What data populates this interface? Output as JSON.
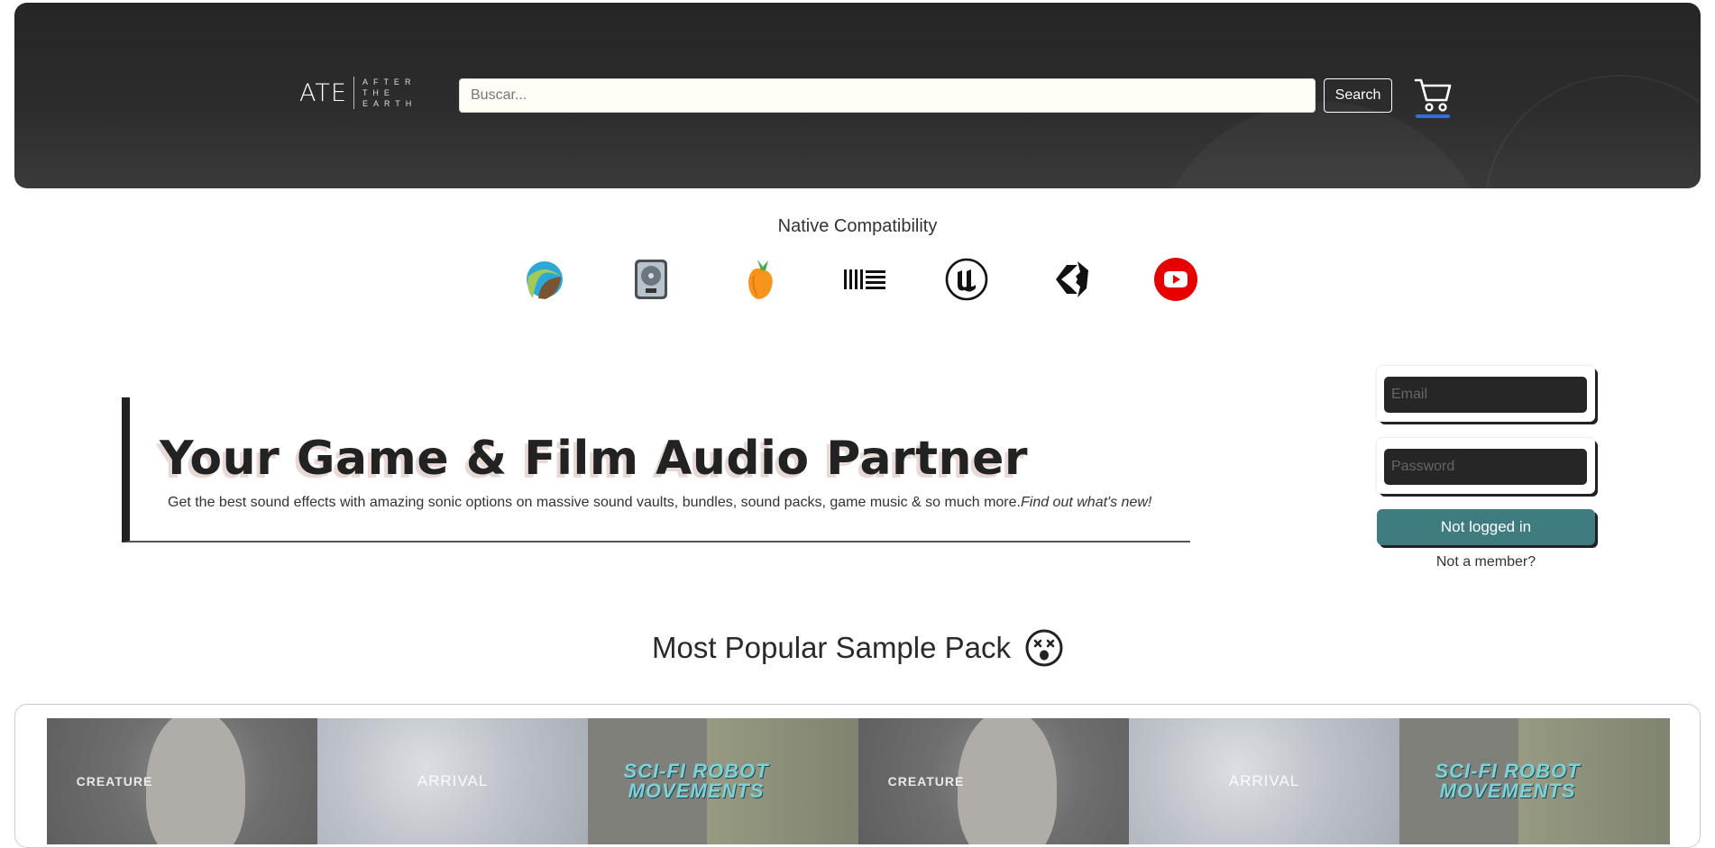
{
  "header": {
    "logo_main": "ATE",
    "logo_words": [
      "AFTER",
      "THE",
      "EARTH"
    ],
    "search_placeholder": "Buscar...",
    "search_label": "Search"
  },
  "compatibility": {
    "title": "Native Compatibility",
    "icons": [
      "reaper-icon",
      "logic-pro-icon",
      "fl-studio-icon",
      "ableton-icon",
      "unreal-engine-icon",
      "unity-icon",
      "youtube-icon"
    ]
  },
  "hero": {
    "title": "Your Game & Film Audio Partner",
    "subtitle": "Get the best sound effects with amazing sonic options on massive sound vaults, bundles, sound packs, game music & so much more.",
    "subtitle_link": "Find out what's new!"
  },
  "login": {
    "email_placeholder": "Email",
    "password_placeholder": "Password",
    "status_button": "Not logged in",
    "member_link": "Not a member?"
  },
  "popular": {
    "title": "Most Popular Sample Pack",
    "packs": [
      {
        "label": "CREATURE"
      },
      {
        "label": "ARRIVAL"
      },
      {
        "label": "SCI-FI ROBOT MOVEMENTS"
      },
      {
        "label": "CREATURE"
      },
      {
        "label": "ARRIVAL"
      },
      {
        "label": "SCI-FI ROBOT MOVEMENTS"
      }
    ]
  },
  "colors": {
    "header_bg": "#2a2a2a",
    "cart_underline": "#2f6fe0",
    "login_button": "#3f7c80",
    "youtube_red": "#e60000"
  }
}
